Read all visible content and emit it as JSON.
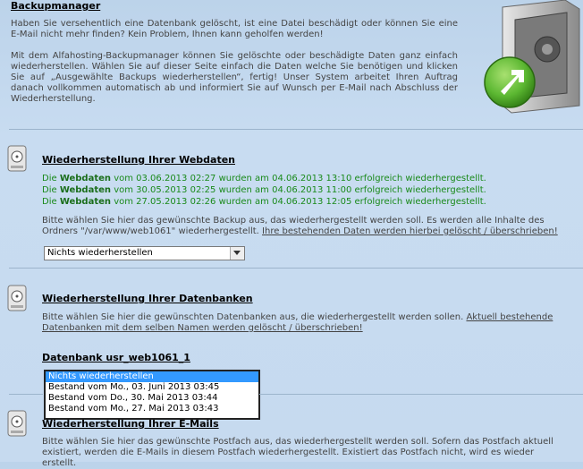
{
  "title": "Backupmanager",
  "intro": {
    "p1": "Haben Sie versehentlich eine Datenbank gelöscht, ist eine Datei beschädigt oder können Sie eine E-Mail nicht mehr finden? Kein Problem, Ihnen kann geholfen werden!",
    "p2": "Mit dem Alfahosting-Backupmanager können Sie gelöschte oder beschädigte Daten ganz einfach wiederherstellen. Wählen Sie auf dieser Seite einfach die Daten welche Sie benötigen und klicken Sie auf „Ausgewählte Backups wiederherstellen“, fertig! Unser System arbeitet Ihren Auftrag danach vollkommen automatisch ab und informiert Sie auf Wunsch per E-Mail nach Abschluss der Wiederherstellung."
  },
  "webdaten": {
    "title": "Wiederherstellung Ihrer Webdaten",
    "restores": [
      {
        "pre": "Die ",
        "bold": "Webdaten",
        "post": " vom 03.06.2013 02:27 wurden am 04.06.2013 13:10 erfolgreich wiederhergestellt."
      },
      {
        "pre": "Die ",
        "bold": "Webdaten",
        "post": " vom 30.05.2013 02:25 wurden am 04.06.2013 11:00 erfolgreich wiederhergestellt."
      },
      {
        "pre": "Die ",
        "bold": "Webdaten",
        "post": " vom 27.05.2013 02:26 wurden am 04.06.2013 12:05 erfolgreich wiederhergestellt."
      }
    ],
    "desc": "Bitte wählen Sie hier das gewünschte Backup aus, das wiederhergestellt werden soll. Es werden alle Inhalte des Ordners \"/var/www/web1061\" wiederhergestellt. ",
    "warning_link": "Ihre bestehenden Daten werden hierbei gelöscht / überschrieben!",
    "select_value": "Nichts wiederherstellen"
  },
  "datenbanken": {
    "title": "Wiederherstellung Ihrer Datenbanken",
    "desc": "Bitte wählen Sie hier die gewünschten Datenbanken aus, die wiederhergestellt werden sollen. ",
    "warning_link": "Aktuell bestehende Datenbanken mit dem selben Namen werden gelöscht / überschrieben!",
    "db_name": "Datenbank usr_web1061_1",
    "options": [
      "Nichts wiederherstellen",
      "Bestand vom Mo., 03. Juni 2013 03:45",
      "Bestand vom Do., 30. Mai 2013 03:44",
      "Bestand vom Mo., 27. Mai 2013 03:43"
    ]
  },
  "emails": {
    "title": "Wiederherstellung Ihrer E-Mails",
    "desc": "Bitte wählen Sie hier das gewünschte Postfach aus, das wiederhergestellt werden soll. Sofern das Postfach aktuell existiert, werden die E-Mails in diesem Postfach wiederhergestellt. Existiert das Postfach nicht, wird es wieder erstellt."
  },
  "colors": {
    "success": "#1a8a1a",
    "selected": "#3399ff",
    "accent_green": "#5cb832"
  }
}
